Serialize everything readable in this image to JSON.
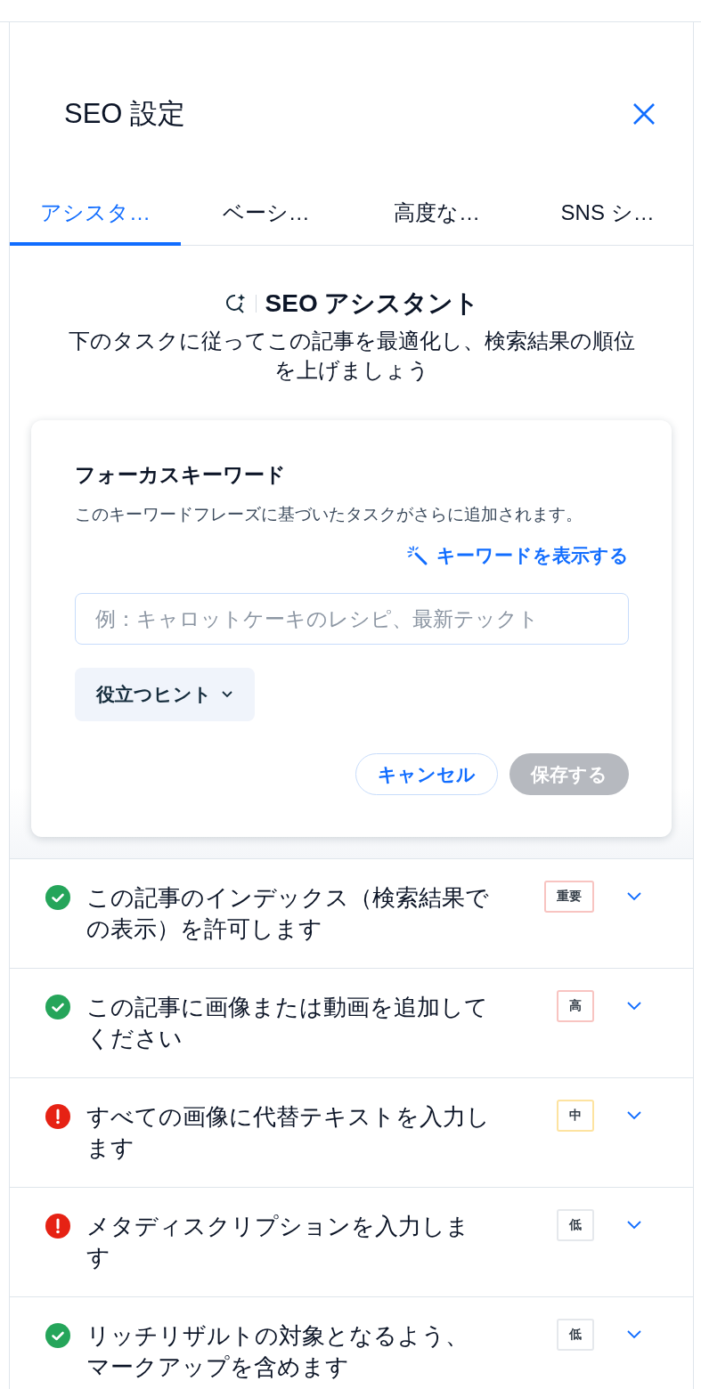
{
  "panel": {
    "title": "SEO 設定"
  },
  "tabs": [
    {
      "label": "アシスタ…",
      "selected": true
    },
    {
      "label": "ベーシ…",
      "selected": false
    },
    {
      "label": "高度な…",
      "selected": false
    },
    {
      "label": "SNS シ…",
      "selected": false
    }
  ],
  "assistant": {
    "heading": "SEO アシスタント",
    "description": "下のタスクに従ってこの記事を最適化し、検索結果の順位を上げましょう"
  },
  "keyword_card": {
    "title": "フォーカスキーワード",
    "description": "このキーワードフレーズに基づいたタスクがさらに追加されます。",
    "link": "キーワードを表示する",
    "input": {
      "placeholder": "例：キャロットケーキのレシピ、最新テックト"
    },
    "hints_button": "役立つヒント",
    "cancel_button": "キャンセル",
    "save_button": {
      "label": "保存する",
      "disabled": true
    }
  },
  "tasks": [
    {
      "text": "この記事のインデックス（検索結果での表示）を許可します",
      "passed": true,
      "priority": "重要",
      "kind": "critical"
    },
    {
      "text": "この記事に画像または動画を追加してください",
      "passed": true,
      "priority": "高",
      "kind": "high"
    },
    {
      "text": "すべての画像に代替テキストを入力します",
      "passed": false,
      "priority": "中",
      "kind": "medium"
    },
    {
      "text": "メタディスクリプションを入力します",
      "passed": false,
      "priority": "低",
      "kind": "low"
    },
    {
      "text": "リッチリザルトの対象となるよう、マークアップを含めます",
      "passed": true,
      "priority": "低",
      "kind": "low"
    }
  ]
}
